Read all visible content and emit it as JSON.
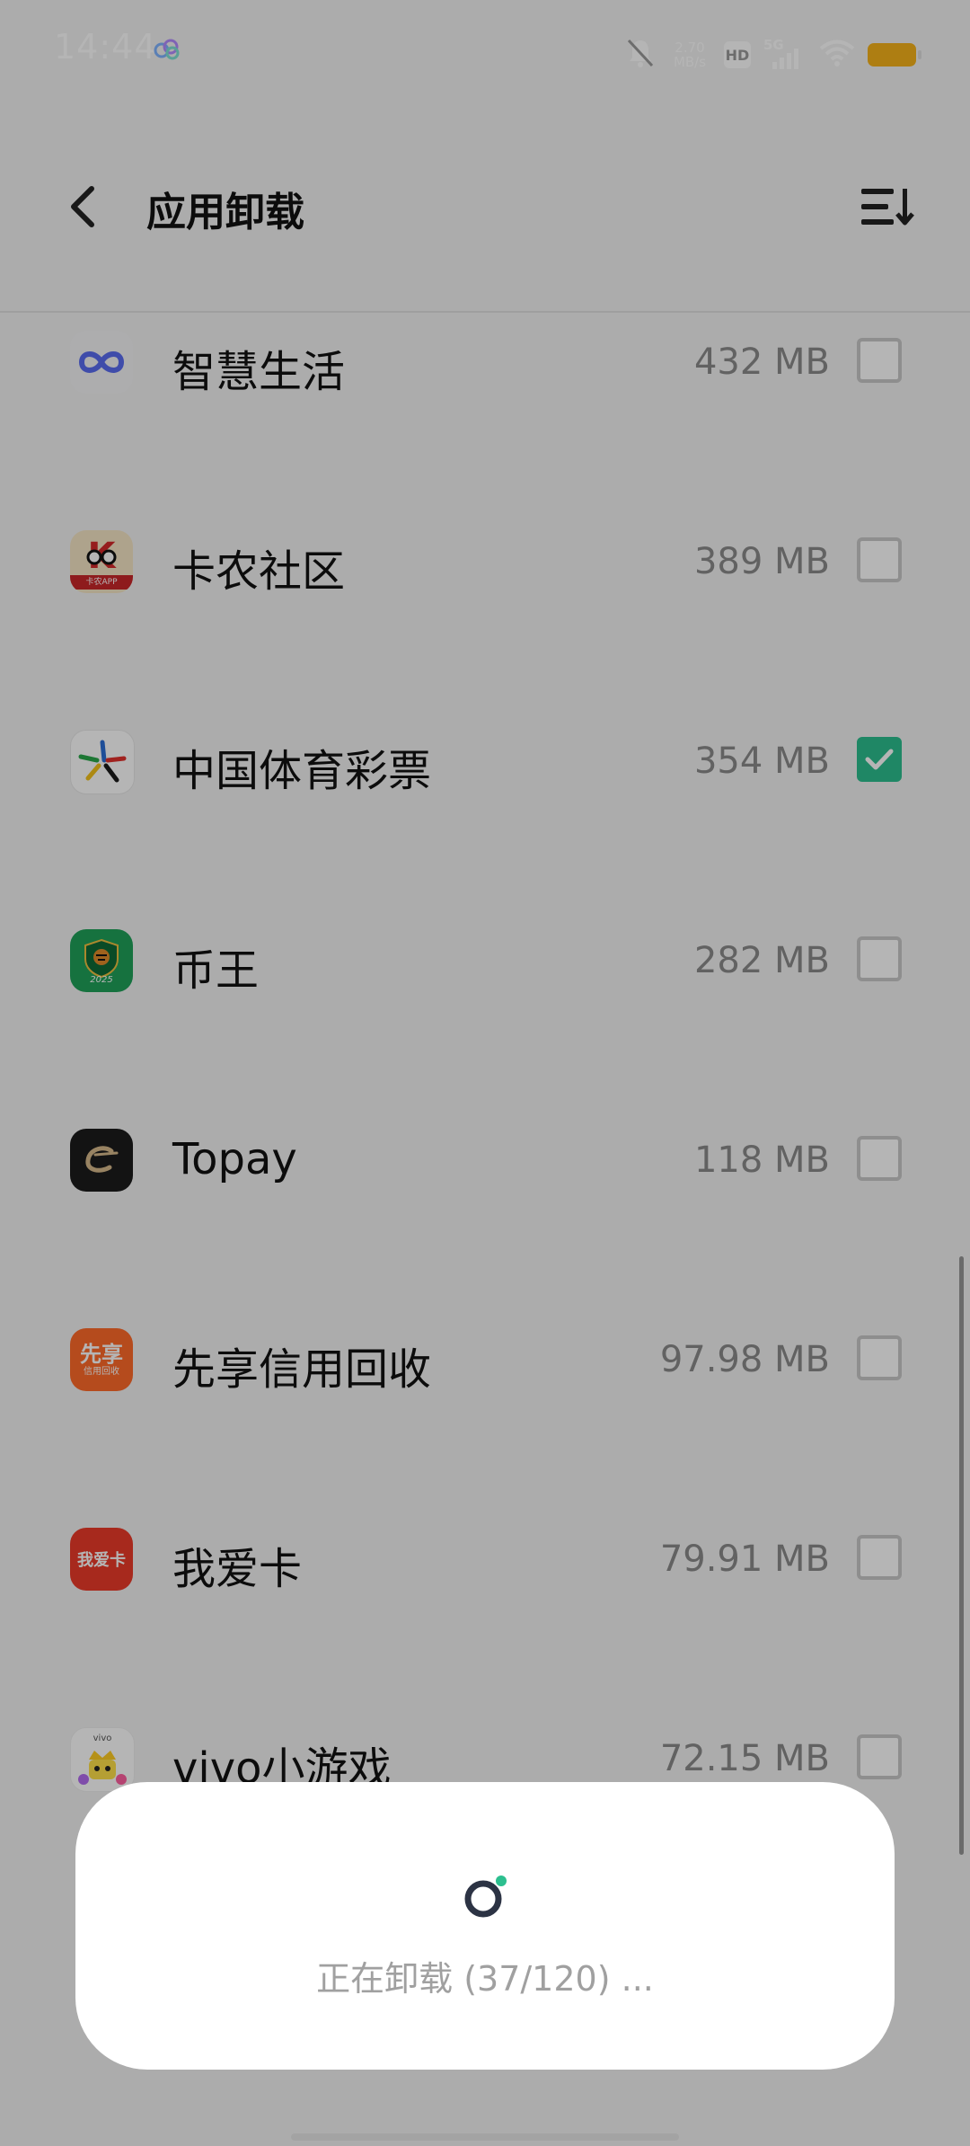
{
  "status_bar": {
    "time": "14:44",
    "net_speed_value": "2.70",
    "net_speed_unit": "MB/s",
    "hd_label": "HD",
    "network_type": "5G",
    "battery_color": "#f5b21a"
  },
  "header": {
    "title": "应用卸载"
  },
  "apps": [
    {
      "name": "智慧生活",
      "size": "432 MB",
      "checked": false,
      "icon": "smart-life-icon"
    },
    {
      "name": "卡农社区",
      "size": "389 MB",
      "checked": false,
      "icon": "kanong-community-icon"
    },
    {
      "name": "中国体育彩票",
      "size": "354 MB",
      "checked": true,
      "icon": "china-sports-lottery-icon"
    },
    {
      "name": "币王",
      "size": "282 MB",
      "checked": false,
      "icon": "biwang-icon"
    },
    {
      "name": "Topay",
      "size": "118 MB",
      "checked": false,
      "icon": "topay-icon"
    },
    {
      "name": "先享信用回收",
      "size": "97.98 MB",
      "checked": false,
      "icon": "xianxiang-credit-icon"
    },
    {
      "name": "我爱卡",
      "size": "79.91 MB",
      "checked": false,
      "icon": "woaika-icon"
    },
    {
      "name": "vivo小游戏",
      "size": "72.15 MB",
      "checked": false,
      "icon": "vivo-minigame-icon"
    }
  ],
  "icon_text": {
    "kanong_caption": "卡农APP",
    "biwang_year": "2025",
    "xianxiang_main": "先享",
    "xianxiang_sub": "信用回收",
    "woaika": "我爱卡",
    "vivo": "vivo"
  },
  "dialog": {
    "message": "正在卸载 (37/120) ..."
  },
  "colors": {
    "accent": "#2cbf8f",
    "overlay": "rgba(0,0,0,0.29)"
  }
}
